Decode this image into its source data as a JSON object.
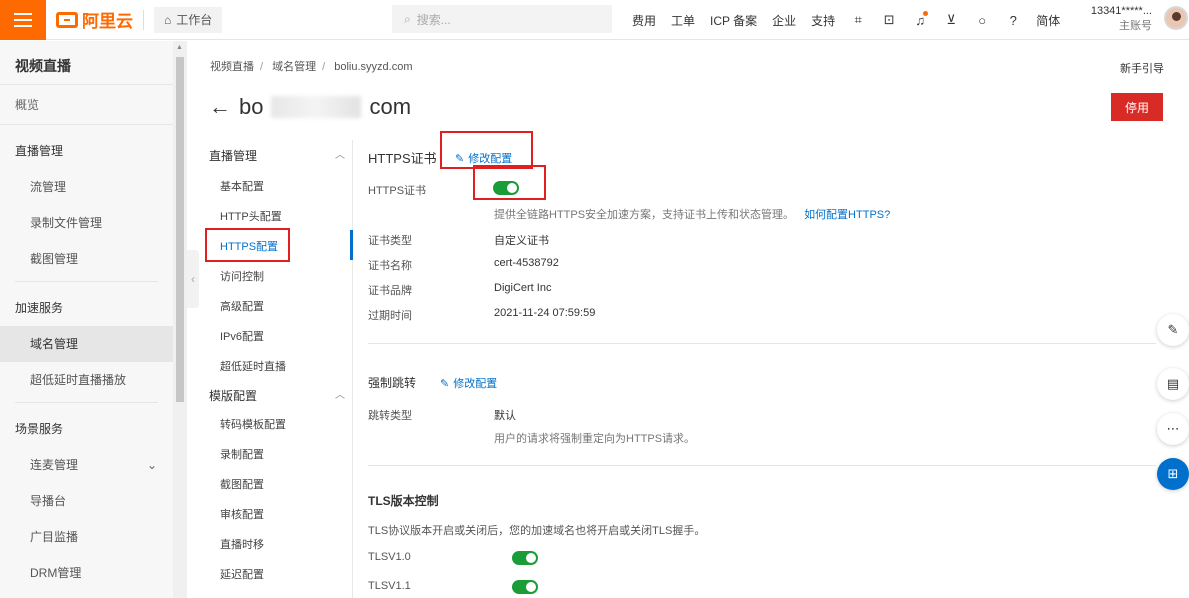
{
  "topbar": {
    "logo_text": "阿里云",
    "workbench": "工作台",
    "search_placeholder": "搜索...",
    "nav": [
      "费用",
      "工单",
      "ICP 备案",
      "企业",
      "支持"
    ],
    "lang": "简体",
    "user_id": "13341*****...",
    "user_role": "主账号"
  },
  "sidebar": {
    "title": "视频直播",
    "overview": "概览",
    "groups": [
      {
        "label": "直播管理",
        "items": [
          "流管理",
          "录制文件管理",
          "截图管理"
        ]
      },
      {
        "label": "加速服务",
        "items": [
          "域名管理",
          "超低延时直播播放"
        ]
      },
      {
        "label": "场景服务",
        "items": [
          "连麦管理",
          "导播台",
          "广目监播",
          "DRM管理"
        ]
      }
    ]
  },
  "breadcrumb": [
    "视频直播",
    "域名管理",
    "boliu.syyzd.com"
  ],
  "guide": "新手引导",
  "page_title": {
    "left": "bo",
    "right": "com"
  },
  "stop_button": "停用",
  "subnav": {
    "group1": "直播管理",
    "group1_items": [
      "基本配置",
      "HTTP头配置",
      "HTTPS配置",
      "访问控制",
      "高级配置",
      "IPv6配置",
      "超低延时直播"
    ],
    "group2": "模版配置",
    "group2_items": [
      "转码模板配置",
      "录制配置",
      "截图配置",
      "审核配置",
      "直播时移",
      "延迟配置"
    ]
  },
  "https": {
    "title": "HTTPS证书",
    "edit": "修改配置",
    "toggle_label": "HTTPS证书",
    "toggle_on": true,
    "hint": "提供全链路HTTPS安全加速方案，支持证书上传和状态管理。",
    "hint_link": "如何配置HTTPS?",
    "rows": [
      {
        "label": "证书类型",
        "value": "自定义证书"
      },
      {
        "label": "证书名称",
        "value": "cert-4538792"
      },
      {
        "label": "证书品牌",
        "value": "DigiCert Inc"
      },
      {
        "label": "过期时间",
        "value": "2021-11-24 07:59:59"
      }
    ]
  },
  "redirect": {
    "title": "强制跳转",
    "edit": "修改配置",
    "label": "跳转类型",
    "value": "默认",
    "hint": "用户的请求将强制重定向为HTTPS请求。"
  },
  "tls": {
    "title": "TLS版本控制",
    "desc": "TLS协议版本开启或关闭后，您的加速域名也将开启或关闭TLS握手。",
    "versions": [
      {
        "label": "TLSV1.0",
        "on": true
      },
      {
        "label": "TLSV1.1",
        "on": true
      }
    ]
  },
  "colors": {
    "brand": "#ff6a00",
    "link": "#0070cc",
    "toggle_on": "#1a9c38",
    "danger": "#d92b25"
  }
}
